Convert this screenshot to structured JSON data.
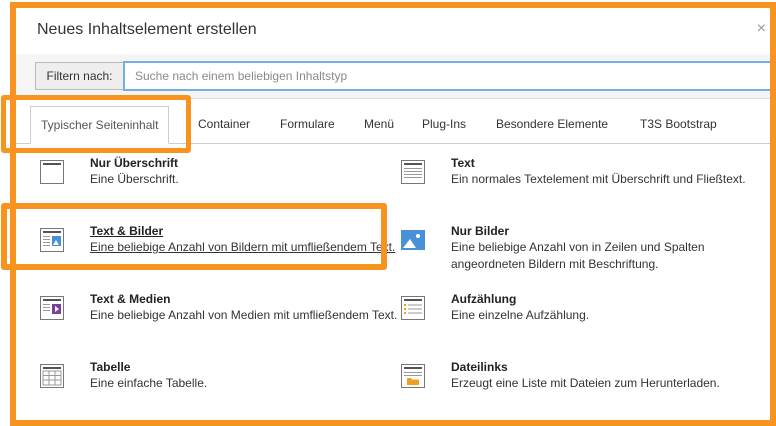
{
  "modal": {
    "title": "Neues Inhaltselement erstellen",
    "close_icon": "×"
  },
  "filter": {
    "label": "Filtern nach:",
    "placeholder": "Suche nach einem beliebigen Inhaltstyp"
  },
  "tabs": [
    {
      "label": "Typischer Seiteninhalt",
      "active": true
    },
    {
      "label": "Container"
    },
    {
      "label": "Formulare"
    },
    {
      "label": "Menü"
    },
    {
      "label": "Plug-Ins"
    },
    {
      "label": "Besondere Elemente"
    },
    {
      "label": "T3S Bootstrap"
    }
  ],
  "items": [
    {
      "title": "Nur Überschrift",
      "desc": "Eine Überschrift.",
      "icon": "header-icon"
    },
    {
      "title": "Text",
      "desc": "Ein normales Textelement mit Überschrift und Fließtext.",
      "icon": "text-icon"
    },
    {
      "title": "Text & Bilder",
      "desc": "Eine beliebige Anzahl von Bildern mit umfließendem Text.",
      "icon": "text-image-icon"
    },
    {
      "title": "Nur Bilder",
      "desc": "Eine beliebige Anzahl von in Zeilen und Spalten angeordneten Bildern mit Beschriftung.",
      "icon": "images-icon"
    },
    {
      "title": "Text & Medien",
      "desc": "Eine beliebige Anzahl von Medien mit umfließendem Text.",
      "icon": "text-media-icon"
    },
    {
      "title": "Aufzählung",
      "desc": "Eine einzelne Aufzählung.",
      "icon": "bullets-icon"
    },
    {
      "title": "Tabelle",
      "desc": "Eine einfache Tabelle.",
      "icon": "table-icon"
    },
    {
      "title": "Dateilinks",
      "desc": "Erzeugt eine Liste mit Dateien zum Herunterladen.",
      "icon": "file-links-icon"
    }
  ],
  "colors": {
    "highlight": "#f7931e",
    "input_border": "#76b0e0"
  }
}
